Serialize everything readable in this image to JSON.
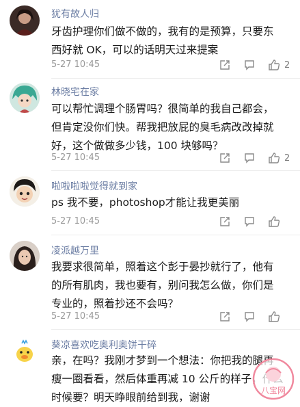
{
  "comments": [
    {
      "username": "犹有故人归",
      "lines": [
        "牙齿护理你们做不做的，我有的是预算，只要东",
        "西好就 OK，可以的话明天过来提案"
      ],
      "time": "5-27 10:45",
      "likes": "2",
      "avatar_icon": "dark-portrait-avatar"
    },
    {
      "username": "林晓宅在家",
      "lines": [
        "可以帮忙调理个肠胃吗？很简单的我自己都会，",
        "但肯定没你们快。帮我把放屁的臭毛病改改掉就",
        "好，这个做做多少钱，100 块够吗？"
      ],
      "time": "5-27 10:45",
      "likes": "2",
      "avatar_icon": "anime-green-hair-avatar"
    },
    {
      "username": "啦啦啦啦觉得就到家",
      "lines": [
        "ps 我不要，photoshop才能让我更美丽"
      ],
      "time": "5-27 10:45",
      "likes": "",
      "avatar_icon": "cartoon-kid-avatar"
    },
    {
      "username": "凌派越万里",
      "lines": [
        "我要求很简单，照着这个彭于晏抄就行了，他有",
        "的所有肌肉，我也要有，别问我怎么做，你们是",
        "专业的，照着抄还不会吗？"
      ],
      "time": "5-27 10:45",
      "likes": "",
      "avatar_icon": "woman-portrait-avatar"
    },
    {
      "username": "葵凉喜欢吃奥利奥饼干碎",
      "lines": [
        "亲，在吗？我刚才梦到一个想法：你把我的腿再",
        "瘦一圈看看，然后体重再减 10 公斤的样子，什么",
        "时候要？明天睁眼前给到我，谢谢"
      ],
      "time": "",
      "likes": "",
      "avatar_icon": "cartoon-duck-avatar"
    }
  ],
  "watermark": "八宝网",
  "colors": {
    "username": "#6b7da3",
    "text": "#1b1b1b",
    "meta": "#9a9a9a",
    "watermark": "#f0899e"
  }
}
